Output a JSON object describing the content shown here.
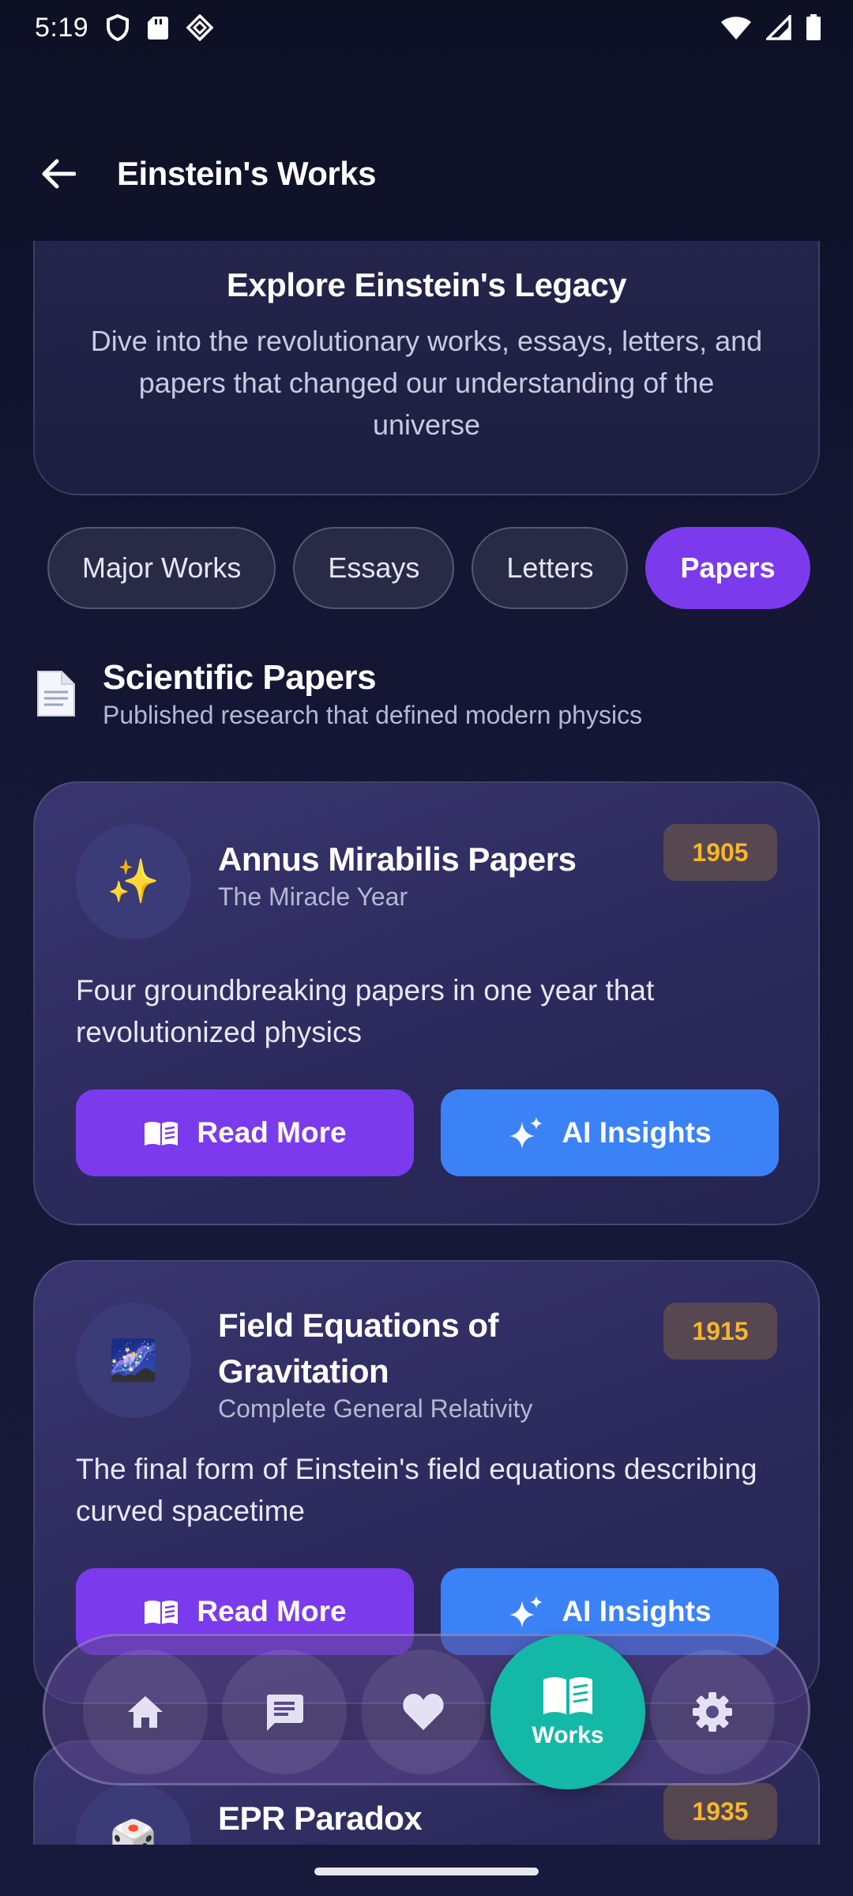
{
  "status_bar": {
    "time": "5:19"
  },
  "app_bar": {
    "title": "Einstein's Works"
  },
  "intro": {
    "title": "Explore Einstein's Legacy",
    "description": "Dive into the revolutionary works, essays, letters, and papers that changed our understanding of the universe"
  },
  "filters": {
    "items": [
      "Major Works",
      "Essays",
      "Letters",
      "Papers"
    ],
    "selected": "Papers"
  },
  "section": {
    "icon": "page-icon",
    "title": "Scientific Papers",
    "subtitle": "Published research that defined modern physics"
  },
  "papers": [
    {
      "emoji": "✨",
      "title": "Annus Mirabilis Papers",
      "subtitle": "The Miracle Year",
      "year": "1905",
      "description": "Four groundbreaking papers in one year that revolutionized physics",
      "read_label": "Read More",
      "ai_label": "AI Insights"
    },
    {
      "emoji": "🌌",
      "title": "Field Equations of Gravitation",
      "subtitle": "Complete General Relativity",
      "year": "1915",
      "description": "The final form of Einstein's field equations describing curved spacetime",
      "read_label": "Read More",
      "ai_label": "AI Insights"
    },
    {
      "emoji": "🎲",
      "title": "EPR Paradox",
      "year": "1935"
    }
  ],
  "bottom_nav": {
    "items": [
      "home-icon",
      "chat-icon",
      "heart-icon",
      "book-icon",
      "gear-icon"
    ],
    "active_label": "Works"
  },
  "colors": {
    "background": "#141634",
    "accent_purple": "#7c3aed",
    "accent_blue": "#3b82f6",
    "accent_teal": "#14b8a6",
    "year_text": "#f5b52e"
  }
}
